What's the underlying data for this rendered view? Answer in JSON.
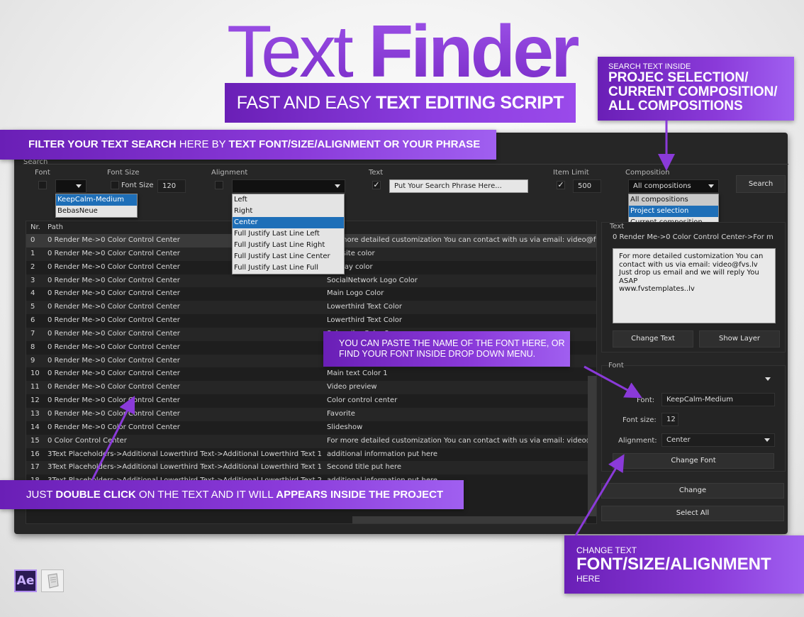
{
  "hero": {
    "title_light": "Text",
    "title_bold": "Finder",
    "subtitle_light": "FAST AND EASY",
    "subtitle_bold": "TEXT EDITING SCRIPT"
  },
  "callouts": {
    "filter": {
      "bold1": "FILTER YOUR TEXT SEARCH",
      "light1": " HERE BY ",
      "bold2": "TEXT FONT/SIZE/ALIGNMENT OR YOUR PHRASE"
    },
    "scope": {
      "small": "SEARCH TEXT INSIDE",
      "line1": "PROJEC SELECTION/",
      "line2": "CURRENT COMPOSITION/",
      "line3": "ALL COMPOSITIONS"
    },
    "font": {
      "line1": "YOU CAN PASTE THE NAME OF THE FONT HERE, OR",
      "line2": "FIND YOUR FONT INSIDE DROP DOWN MENU."
    },
    "dblclick": {
      "light1": "JUST ",
      "bold1": "DOUBLE CLICK",
      "light2": " ON THE TEXT AND IT WILL ",
      "bold2": "APPEARS INSIDE THE PROJECT"
    },
    "change": {
      "small1": "CHANGE TEXT",
      "big": "FONT/SIZE/ALIGNMENT",
      "small2": "HERE"
    }
  },
  "search": {
    "group_label": "Search",
    "font_label": "Font",
    "font_size_label": "Font Size",
    "font_size_inner_label": "Font Size",
    "font_size_value": "120",
    "alignment_label": "Alignment",
    "text_label": "Text",
    "text_placeholder": "Put Your Search Phrase Here...",
    "item_limit_label": "Item Limit",
    "item_limit_value": "500",
    "composition_label": "Composition",
    "composition_value": "All compositions",
    "search_button": "Search",
    "font_options": [
      "KeepCalm-Medium",
      "BebasNeue"
    ],
    "alignment_options": [
      "Left",
      "Right",
      "Center",
      "Full Justify Last Line Left",
      "Full Justify Last Line Right",
      "Full Justify Last Line Center",
      "Full Justify Last Line Full"
    ],
    "composition_options": [
      "All compositions",
      "Project selection",
      "Current composition"
    ]
  },
  "table": {
    "headers": {
      "nr": "Nr.",
      "path": "Path",
      "text": "Text"
    },
    "rows": [
      {
        "nr": "0",
        "path": "0 Render Me->0 Color Control Center",
        "text": "For more detailed customization You can contact with us via email: video@fvs"
      },
      {
        "nr": "1",
        "path": "0 Render Me->0 Color Control Center",
        "text": "Website color"
      },
      {
        "nr": "2",
        "path": "0 Render Me->0 Color Control Center",
        "text": "Display color"
      },
      {
        "nr": "3",
        "path": "0 Render Me->0 Color Control Center",
        "text": "SocialNetwork Logo Color"
      },
      {
        "nr": "4",
        "path": "0 Render Me->0 Color Control Center",
        "text": "Main Logo Color"
      },
      {
        "nr": "5",
        "path": "0 Render Me->0 Color Control Center",
        "text": "Lowerthird Text Color"
      },
      {
        "nr": "6",
        "path": "0 Render Me->0 Color Control Center",
        "text": "Lowerthird Text Color"
      },
      {
        "nr": "7",
        "path": "0 Render Me->0 Color Control Center",
        "text": "Subscribe Color 2"
      },
      {
        "nr": "8",
        "path": "0 Render Me->0 Color Control Center",
        "text": ""
      },
      {
        "nr": "9",
        "path": "0 Render Me->0 Color Control Center",
        "text": ""
      },
      {
        "nr": "10",
        "path": "0 Render Me->0 Color Control Center",
        "text": "Main text Color 1"
      },
      {
        "nr": "11",
        "path": "0 Render Me->0 Color Control Center",
        "text": "Video preview"
      },
      {
        "nr": "12",
        "path": "0 Render Me->0 Color Control Center",
        "text": "Color control center"
      },
      {
        "nr": "13",
        "path": "0 Render Me->0 Color Control Center",
        "text": "Favorite"
      },
      {
        "nr": "14",
        "path": "0 Render Me->0 Color Control Center",
        "text": "Slideshow"
      },
      {
        "nr": "15",
        "path": "0 Color Control Center",
        "text": "For more detailed customization You can contact with us via email: video@fvs"
      },
      {
        "nr": "16",
        "path": "3Text Placeholders->Additional Lowerthird Text->Additional Lowerthird Text 1",
        "text": "additional information put here"
      },
      {
        "nr": "17",
        "path": "3Text Placeholders->Additional Lowerthird Text->Additional Lowerthird Text 1",
        "text": "Second title put here"
      },
      {
        "nr": "18",
        "path": "3Text Placeholders->Additional Lowerthird Text->Additional Lowerthird Text 2",
        "text": "additional information put here"
      }
    ]
  },
  "right_panel": {
    "text_group_label": "Text",
    "text_path": "0 Render Me->0 Color Control Center->For m",
    "text_content": "For more detailed customization You can contact with us via email: video@fvs.lv\nJust drop us email and we will reply You ASAP\nwww.fvstemplates..lv",
    "change_text_button": "Change Text",
    "show_layer_button": "Show Layer",
    "font_group_label": "Font",
    "font_field_label": "Font:",
    "font_field_value": "KeepCalm-Medium",
    "font_size_field_label": "Font size:",
    "font_size_field_value": "12",
    "alignment_field_label": "Alignment:",
    "alignment_field_value": "Center",
    "change_font_button": "Change Font",
    "change_button": "Change",
    "select_all_button": "Select All"
  },
  "footer_icons": {
    "ae_label": "Ae"
  },
  "colors": {
    "accent_purple": "#8a3ad9",
    "selection_blue": "#1e6fb8",
    "panel_bg": "#262626"
  }
}
